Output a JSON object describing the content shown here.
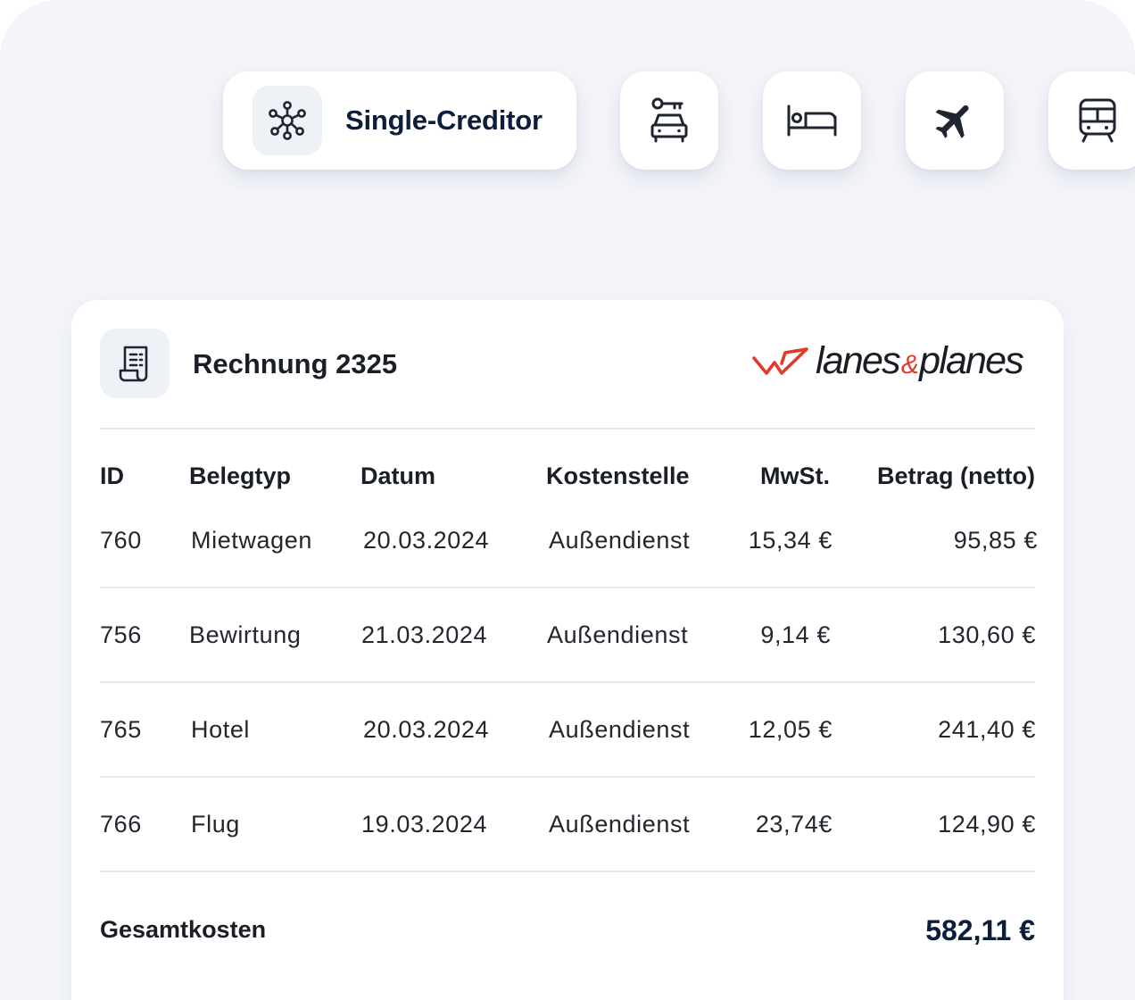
{
  "chips": {
    "main_label": "Single-Creditor",
    "items": [
      "network-icon",
      "car-rental-icon",
      "hotel-bed-icon",
      "airplane-icon",
      "train-icon"
    ]
  },
  "invoice": {
    "title": "Rechnung 2325",
    "brand": {
      "left": "lanes",
      "amp": "&",
      "right": "planes",
      "accent_color": "#e13a2a"
    },
    "headers": {
      "id": "ID",
      "type": "Belegtyp",
      "date": "Datum",
      "cost_center": "Kostenstelle",
      "vat": "MwSt.",
      "amount": "Betrag (netto)"
    },
    "rows": [
      {
        "id": "760",
        "type": "Mietwagen",
        "date": "20.03.2024",
        "cost_center": "Außendienst",
        "vat": "15,34 €",
        "amount": "95,85 €"
      },
      {
        "id": "756",
        "type": "Bewirtung",
        "date": "21.03.2024",
        "cost_center": "Außendienst",
        "vat": "9,14 €",
        "amount": "130,60 €"
      },
      {
        "id": "765",
        "type": "Hotel",
        "date": "20.03.2024",
        "cost_center": "Außendienst",
        "vat": "12,05 €",
        "amount": "241,40 €"
      },
      {
        "id": "766",
        "type": "Flug",
        "date": "19.03.2024",
        "cost_center": "Außendienst",
        "vat": "23,74€",
        "amount": "124,90 €"
      }
    ],
    "total_label": "Gesamtkosten",
    "total_value": "582,11 €"
  },
  "colors": {
    "background": "#f3f5fa",
    "text_dark": "#0d1e3d",
    "divider": "#e6e8ec"
  }
}
